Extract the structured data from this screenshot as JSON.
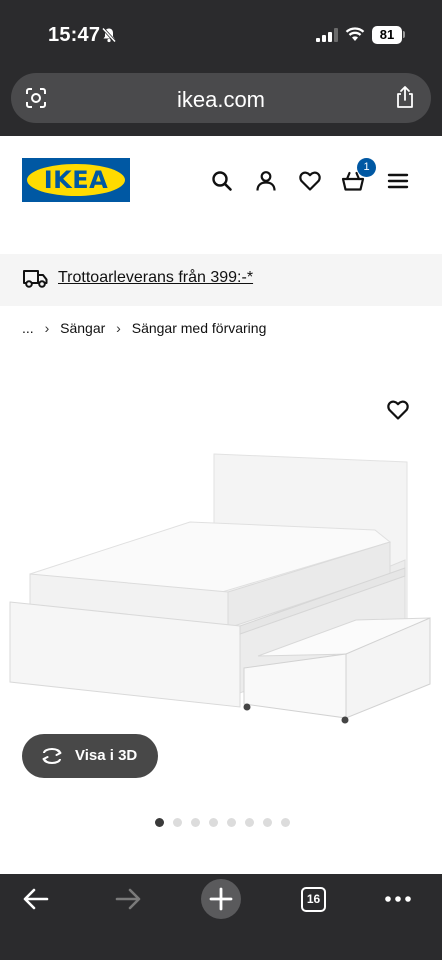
{
  "status_bar": {
    "time": "15:47",
    "battery": "81"
  },
  "browser": {
    "url": "ikea.com",
    "open_tabs": "16"
  },
  "header": {
    "logo_text": "IKEA",
    "cart_count": "1"
  },
  "delivery_banner": {
    "text": "Trottoarleverans från 399:-*"
  },
  "breadcrumb": {
    "items": [
      "...",
      "Sängar",
      "Sängar med förvaring"
    ]
  },
  "product": {
    "view_3d_label": "Visa i 3D",
    "image_count": 8,
    "active_image_index": 0
  },
  "colors": {
    "ikea_blue": "#0058a3",
    "ikea_yellow": "#ffdb00",
    "chrome_dark": "#2b2b2d"
  },
  "icons": [
    "do-not-disturb-bell-icon",
    "lens-icon",
    "share-icon",
    "search-icon",
    "account-icon",
    "heart-icon",
    "basket-icon",
    "menu-icon",
    "truck-icon",
    "rotate-3d-icon",
    "back-arrow-icon",
    "forward-arrow-icon",
    "plus-icon",
    "more-icon"
  ]
}
